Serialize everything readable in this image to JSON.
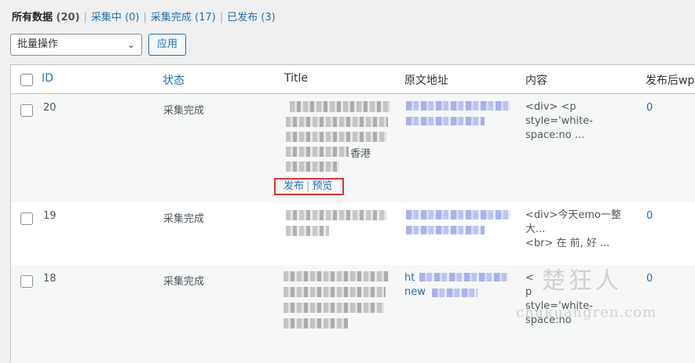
{
  "filters": {
    "all": {
      "label": "所有数据",
      "count": "(20)"
    },
    "collecting": {
      "label": "采集中",
      "count": "(0)"
    },
    "done": {
      "label": "采集完成",
      "count": "(17)"
    },
    "published": {
      "label": "已发布",
      "count": "(3)"
    },
    "separator": "|"
  },
  "bulk": {
    "selected": "批量操作",
    "apply_label": "应用"
  },
  "columns": [
    "ID",
    "状态",
    "Title",
    "原文地址",
    "内容",
    "发布后wp"
  ],
  "rows": [
    {
      "id": "20",
      "status": "采集完成",
      "title_visible": "香港",
      "content": "<div> <p\nstyle='white-\nspace:no ...",
      "wp": "0"
    },
    {
      "id": "19",
      "status": "采集完成",
      "title_visible": "",
      "content": "<div>今天emo一整\n大...\n<br> 在 前, 好 ...",
      "wp": "0"
    },
    {
      "id": "18",
      "status": "采集完成",
      "title_visible": "",
      "url_visible": "ht\nnew",
      "content": "<\np\nstyle='white-\nspace:no",
      "wp": "0"
    }
  ],
  "row_actions": {
    "publish": "发布",
    "preview": "预览",
    "separator": "|"
  },
  "watermark": {
    "cn": "楚狂人",
    "en": "chukuangren.com"
  }
}
